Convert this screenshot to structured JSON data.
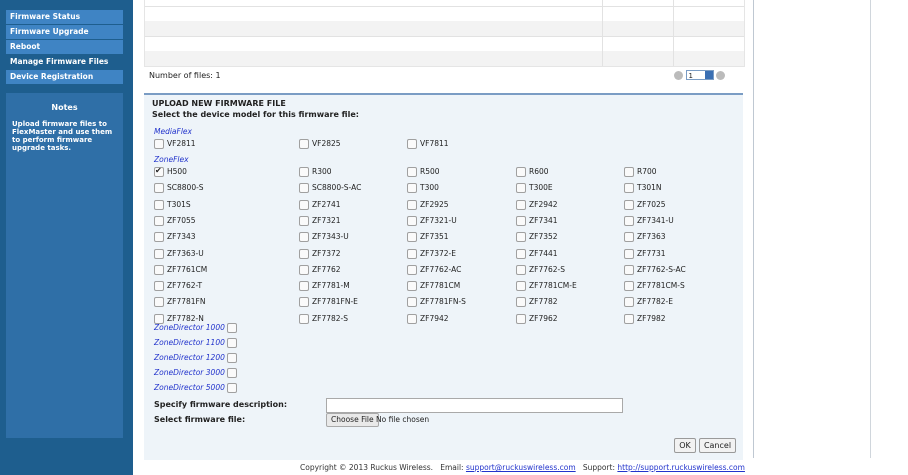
{
  "sidebar": {
    "items": [
      {
        "label": "Firmware Status"
      },
      {
        "label": "Firmware Upgrade"
      },
      {
        "label": "Reboot"
      },
      {
        "label": "Manage Firmware Files"
      },
      {
        "label": "Device Registration"
      }
    ],
    "notes": {
      "title": "Notes",
      "text": "Upload firmware files to FlexMaster and use them to perform firmware upgrade tasks."
    }
  },
  "files": {
    "count_label": "Number of files: 1",
    "page_value": "1"
  },
  "upload": {
    "title": "UPLOAD NEW FIRMWARE FILE",
    "subtitle": "Select the device model for this firmware file:",
    "mediaflex": {
      "label": "MediaFlex",
      "models": [
        "VF2811",
        "VF2825",
        "VF7811"
      ]
    },
    "zoneflex": {
      "label": "ZoneFlex",
      "models": [
        "H500",
        "R300",
        "R500",
        "R600",
        "R700",
        "SC8800-S",
        "SC8800-S-AC",
        "T300",
        "T300E",
        "T301N",
        "T301S",
        "ZF2741",
        "ZF2925",
        "ZF2942",
        "ZF7025",
        "ZF7055",
        "ZF7321",
        "ZF7321-U",
        "ZF7341",
        "ZF7341-U",
        "ZF7343",
        "ZF7343-U",
        "ZF7351",
        "ZF7352",
        "ZF7363",
        "ZF7363-U",
        "ZF7372",
        "ZF7372-E",
        "ZF7441",
        "ZF7731",
        "ZF7761CM",
        "ZF7762",
        "ZF7762-AC",
        "ZF7762-S",
        "ZF7762-S-AC",
        "ZF7762-T",
        "ZF7781-M",
        "ZF7781CM",
        "ZF7781CM-E",
        "ZF7781CM-S",
        "ZF7781FN",
        "ZF7781FN-E",
        "ZF7781FN-S",
        "ZF7782",
        "ZF7782-E",
        "ZF7782-N",
        "ZF7782-S",
        "ZF7942",
        "ZF7962",
        "ZF7982"
      ],
      "checked": [
        "H500"
      ]
    },
    "zonedirectors": [
      "ZoneDirector 1000",
      "ZoneDirector 1100",
      "ZoneDirector 1200",
      "ZoneDirector 3000",
      "ZoneDirector 5000"
    ],
    "desc_label": "Specify firmware description:",
    "desc_value": "",
    "file_label": "Select firmware file:",
    "choose_file_label": "Choose File",
    "no_file_text": "No file chosen",
    "ok_label": "OK",
    "cancel_label": "Cancel"
  },
  "footer": {
    "copyright": "Copyright © 2013 Ruckus Wireless.",
    "email_label": "Email:",
    "email": "support@ruckuswireless.com",
    "support_label": "Support:",
    "support_url": "http://support.ruckuswireless.com"
  }
}
